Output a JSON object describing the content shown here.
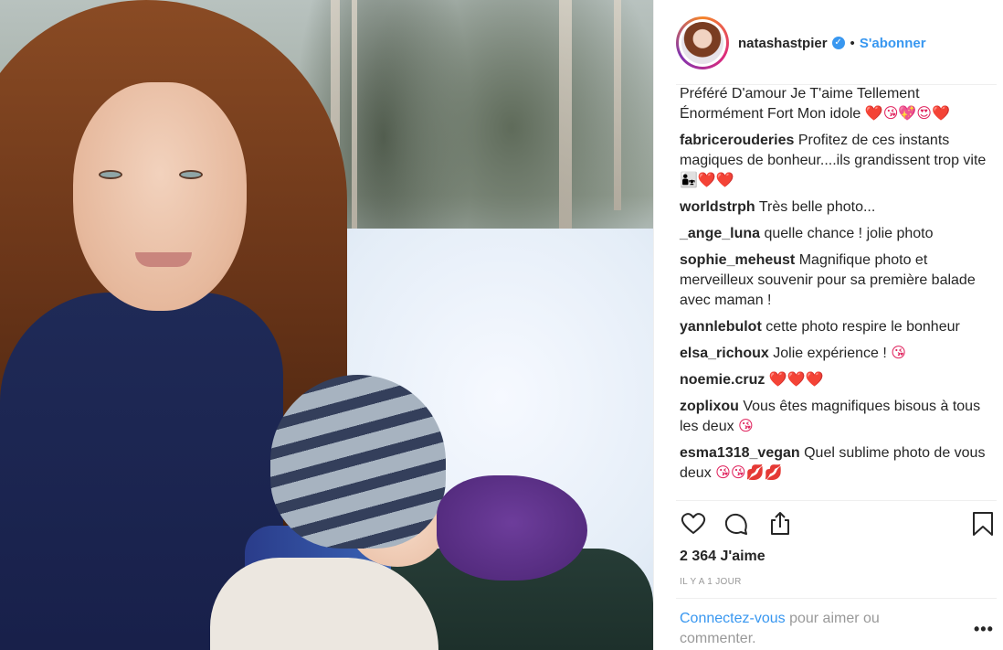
{
  "post": {
    "username": "natashastpier",
    "follow_label": "S'abonner",
    "separator": "•",
    "verified_glyph": "✓"
  },
  "comments": [
    {
      "user": "",
      "text": "Préféré D'amour Je T'aime Tellement Énormément Fort Mon idole",
      "emoji": "❤️😘💖😍❤️"
    },
    {
      "user": "fabricerouderies",
      "text": "Profitez de ces instants magiques de bonheur....ils grandissent trop vite",
      "emoji": "👨‍👧❤️❤️"
    },
    {
      "user": "worldstrph",
      "text": "Très belle photo...",
      "emoji": ""
    },
    {
      "user": "_ange_luna",
      "text": "quelle chance ! jolie photo",
      "emoji": ""
    },
    {
      "user": "sophie_meheust",
      "text": "Magnifique photo et merveilleux souvenir pour sa première balade avec maman !",
      "emoji": ""
    },
    {
      "user": "yannlebulot",
      "text": "cette photo respire le bonheur",
      "emoji": ""
    },
    {
      "user": "elsa_richoux",
      "text": "Jolie expérience !",
      "emoji": "😘"
    },
    {
      "user": "noemie.cruz",
      "text": "",
      "emoji": "❤️❤️❤️"
    },
    {
      "user": "zoplixou",
      "text": "Vous êtes magnifiques bisous à tous les deux",
      "emoji": "😘"
    },
    {
      "user": "esma1318_vegan",
      "text": "Quel sublime photo de vous deux",
      "emoji": "😘😘💋💋"
    }
  ],
  "stats": {
    "likes": "2 364 J'aime",
    "time": "IL Y A 1 JOUR"
  },
  "login": {
    "link": "Connectez-vous",
    "rest": " pour aimer ou commenter."
  },
  "more_glyph": "•••",
  "icons": {
    "like": "heart-icon",
    "comment": "comment-icon",
    "share": "share-icon",
    "save": "bookmark-icon"
  },
  "colors": {
    "accent": "#3897f0",
    "text": "#262626",
    "muted": "#999999",
    "border": "#efefef"
  }
}
